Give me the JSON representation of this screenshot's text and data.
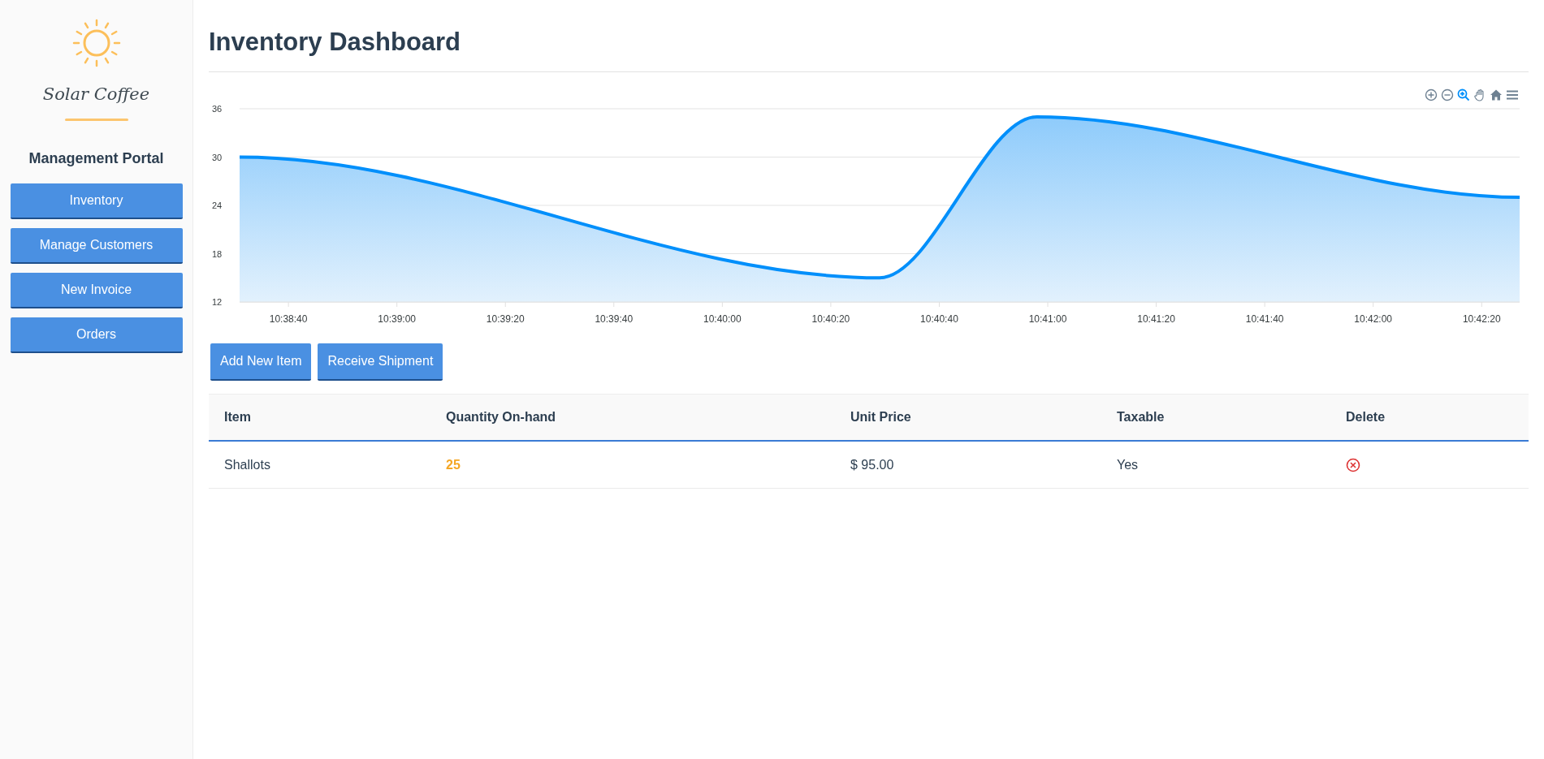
{
  "sidebar": {
    "brand": "Solar Coffee",
    "heading": "Management Portal",
    "nav": [
      "Inventory",
      "Manage Customers",
      "New Invoice",
      "Orders"
    ]
  },
  "page_title": "Inventory Dashboard",
  "chart": {
    "toolbar": [
      {
        "kind": "zoom-in",
        "selected": false
      },
      {
        "kind": "zoom-out",
        "selected": false
      },
      {
        "kind": "zoom-select",
        "selected": true
      },
      {
        "kind": "pan",
        "selected": false
      },
      {
        "kind": "reset",
        "selected": false
      },
      {
        "kind": "menu",
        "selected": false
      }
    ],
    "chart_data": {
      "type": "area",
      "x": [
        38311,
        38429,
        38458,
        38547
      ],
      "series": [
        {
          "color": "#008ffb",
          "values": [
            30,
            15,
            35,
            25
          ]
        }
      ],
      "grid": true,
      "xlim": [
        38311,
        38547
      ],
      "ylim": [
        12,
        36
      ],
      "yticks": [
        12,
        18,
        24,
        30,
        36
      ],
      "xticks": [
        {
          "value": 38320,
          "label": "10:38:40"
        },
        {
          "value": 38340,
          "label": "10:39:00"
        },
        {
          "value": 38360,
          "label": "10:39:20"
        },
        {
          "value": 38380,
          "label": "10:39:40"
        },
        {
          "value": 38400,
          "label": "10:40:00"
        },
        {
          "value": 38420,
          "label": "10:40:20"
        },
        {
          "value": 38440,
          "label": "10:40:40"
        },
        {
          "value": 38460,
          "label": "10:41:00"
        },
        {
          "value": 38480,
          "label": "10:41:20"
        },
        {
          "value": 38500,
          "label": "10:41:40"
        },
        {
          "value": 38520,
          "label": "10:42:00"
        },
        {
          "value": 38540,
          "label": "10:42:20"
        }
      ]
    }
  },
  "actions": [
    "Add New Item",
    "Receive Shipment"
  ],
  "table": {
    "columns": [
      "Item",
      "Quantity On-hand",
      "Unit Price",
      "Taxable",
      "Delete"
    ],
    "rows": [
      {
        "item": "Shallots",
        "quantity": "25",
        "quantity_warning": true,
        "unit_price": "$ 95.00",
        "taxable": "Yes"
      }
    ]
  }
}
